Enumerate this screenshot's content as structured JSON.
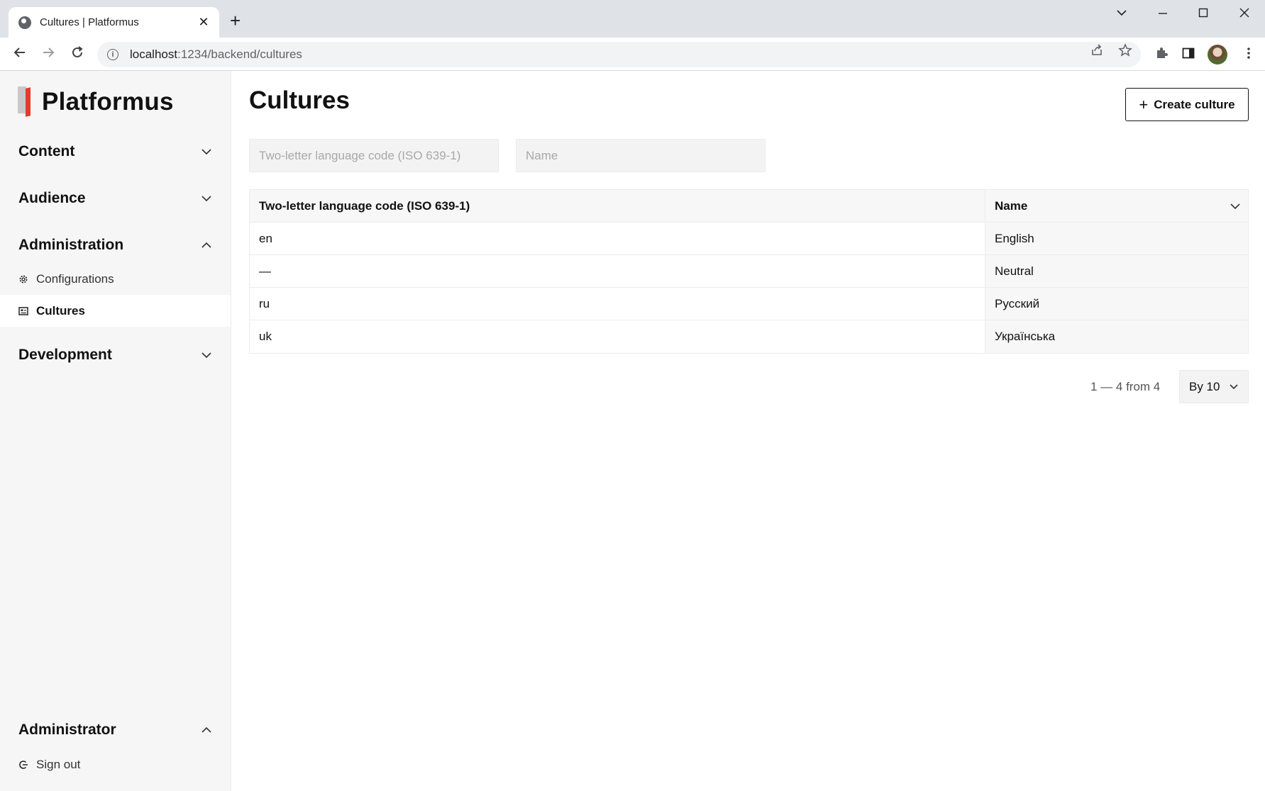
{
  "browser": {
    "tab_title": "Cultures | Platformus",
    "url_host": "localhost",
    "url_rest": ":1234/backend/cultures"
  },
  "sidebar": {
    "logo_text": "Platformus",
    "sections": [
      {
        "label": "Content",
        "expanded": false
      },
      {
        "label": "Audience",
        "expanded": false
      },
      {
        "label": "Administration",
        "expanded": true
      },
      {
        "label": "Development",
        "expanded": false
      }
    ],
    "admin_items": [
      {
        "label": "Configurations",
        "icon": "gear-icon",
        "active": false
      },
      {
        "label": "Cultures",
        "icon": "culture-icon",
        "active": true
      }
    ],
    "user": {
      "label": "Administrator",
      "signout": "Sign out"
    }
  },
  "main": {
    "title": "Cultures",
    "create_label": "Create culture",
    "filters": {
      "code_placeholder": "Two-letter language code (ISO 639-1)",
      "name_placeholder": "Name"
    },
    "table": {
      "columns": [
        "Two-letter language code (ISO 639-1)",
        "Name"
      ],
      "rows": [
        {
          "code": "en",
          "name": "English"
        },
        {
          "code": "—",
          "name": "Neutral"
        },
        {
          "code": "ru",
          "name": "Русский"
        },
        {
          "code": "uk",
          "name": "Українська"
        }
      ]
    },
    "pager": {
      "summary": "1 — 4 from 4",
      "page_size": "By 10"
    }
  }
}
